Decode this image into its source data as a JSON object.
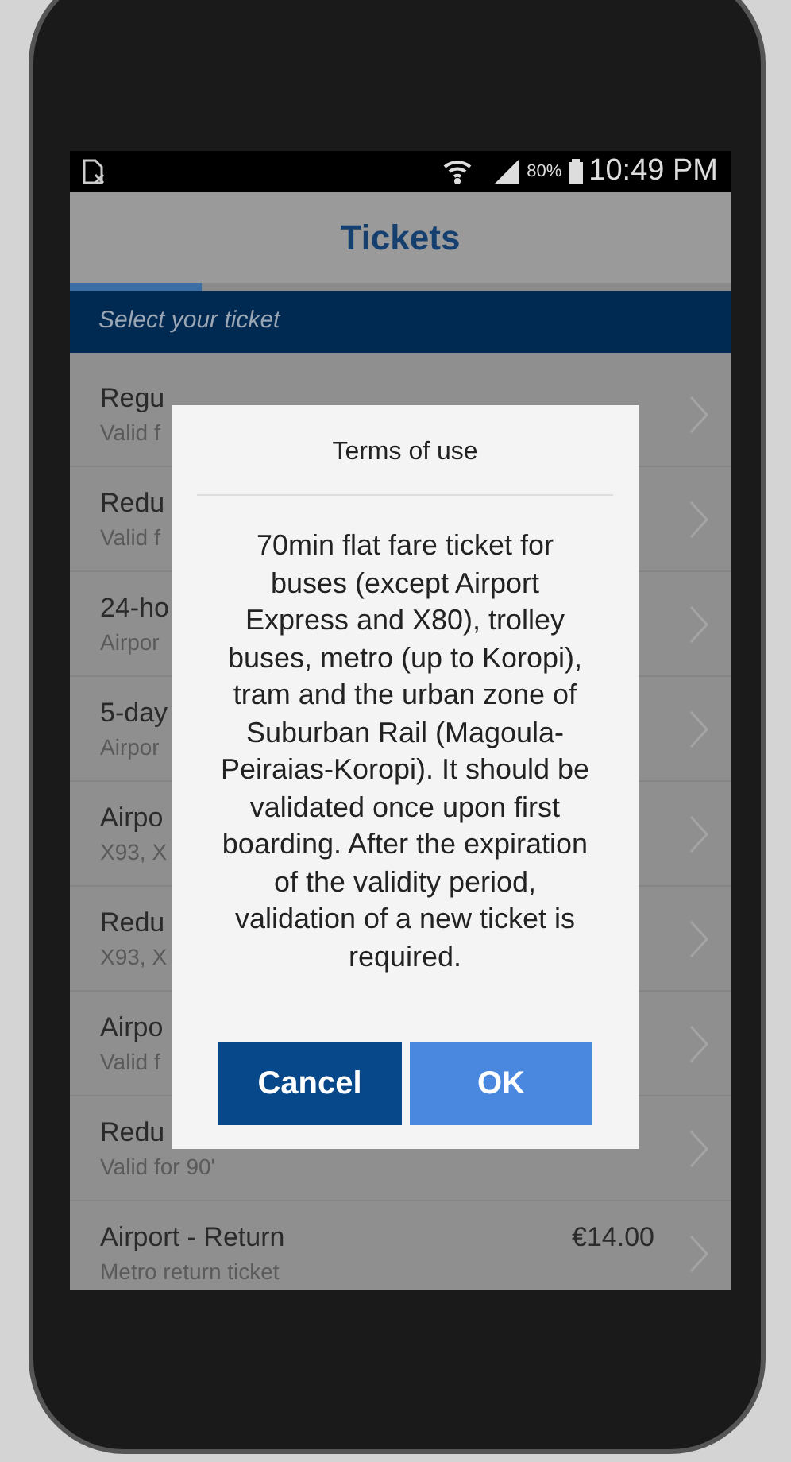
{
  "status_bar": {
    "battery": "80%",
    "time": "10:49 PM"
  },
  "header": {
    "title": "Tickets",
    "progress": {
      "level": 0.2
    }
  },
  "section": {
    "label": "Select your ticket"
  },
  "rows": [
    {
      "title": "Regu",
      "subtitle": "Valid f"
    },
    {
      "title": "Redu",
      "subtitle": "Valid f"
    },
    {
      "title": "24-ho",
      "subtitle": "Airpor"
    },
    {
      "title": "5-day",
      "subtitle": "Airpor"
    },
    {
      "title": "Airpo",
      "subtitle": "X93, X"
    },
    {
      "title": "Redu",
      "subtitle": "X93, X"
    },
    {
      "title": "Airpo",
      "subtitle": "Valid f"
    },
    {
      "title": "Redu",
      "subtitle": "Valid for 90'"
    },
    {
      "title": "Airport - Return",
      "subtitle": "Metro return ticket",
      "price": "€14.00"
    }
  ],
  "dialog": {
    "title": "Terms of use",
    "body": "70min flat fare ticket for buses (except Airport Express and X80), trolley buses, metro (up to Koropi), tram and the urban zone of Suburban Rail (Magoula-Peiraias-Koropi). It should be validated once upon first boarding. After the expiration of the validity period, validation of a new ticket is required.",
    "buttons": [
      {
        "label": "Cancel",
        "kind": "secondary"
      },
      {
        "label": "OK",
        "kind": "primary"
      }
    ]
  }
}
